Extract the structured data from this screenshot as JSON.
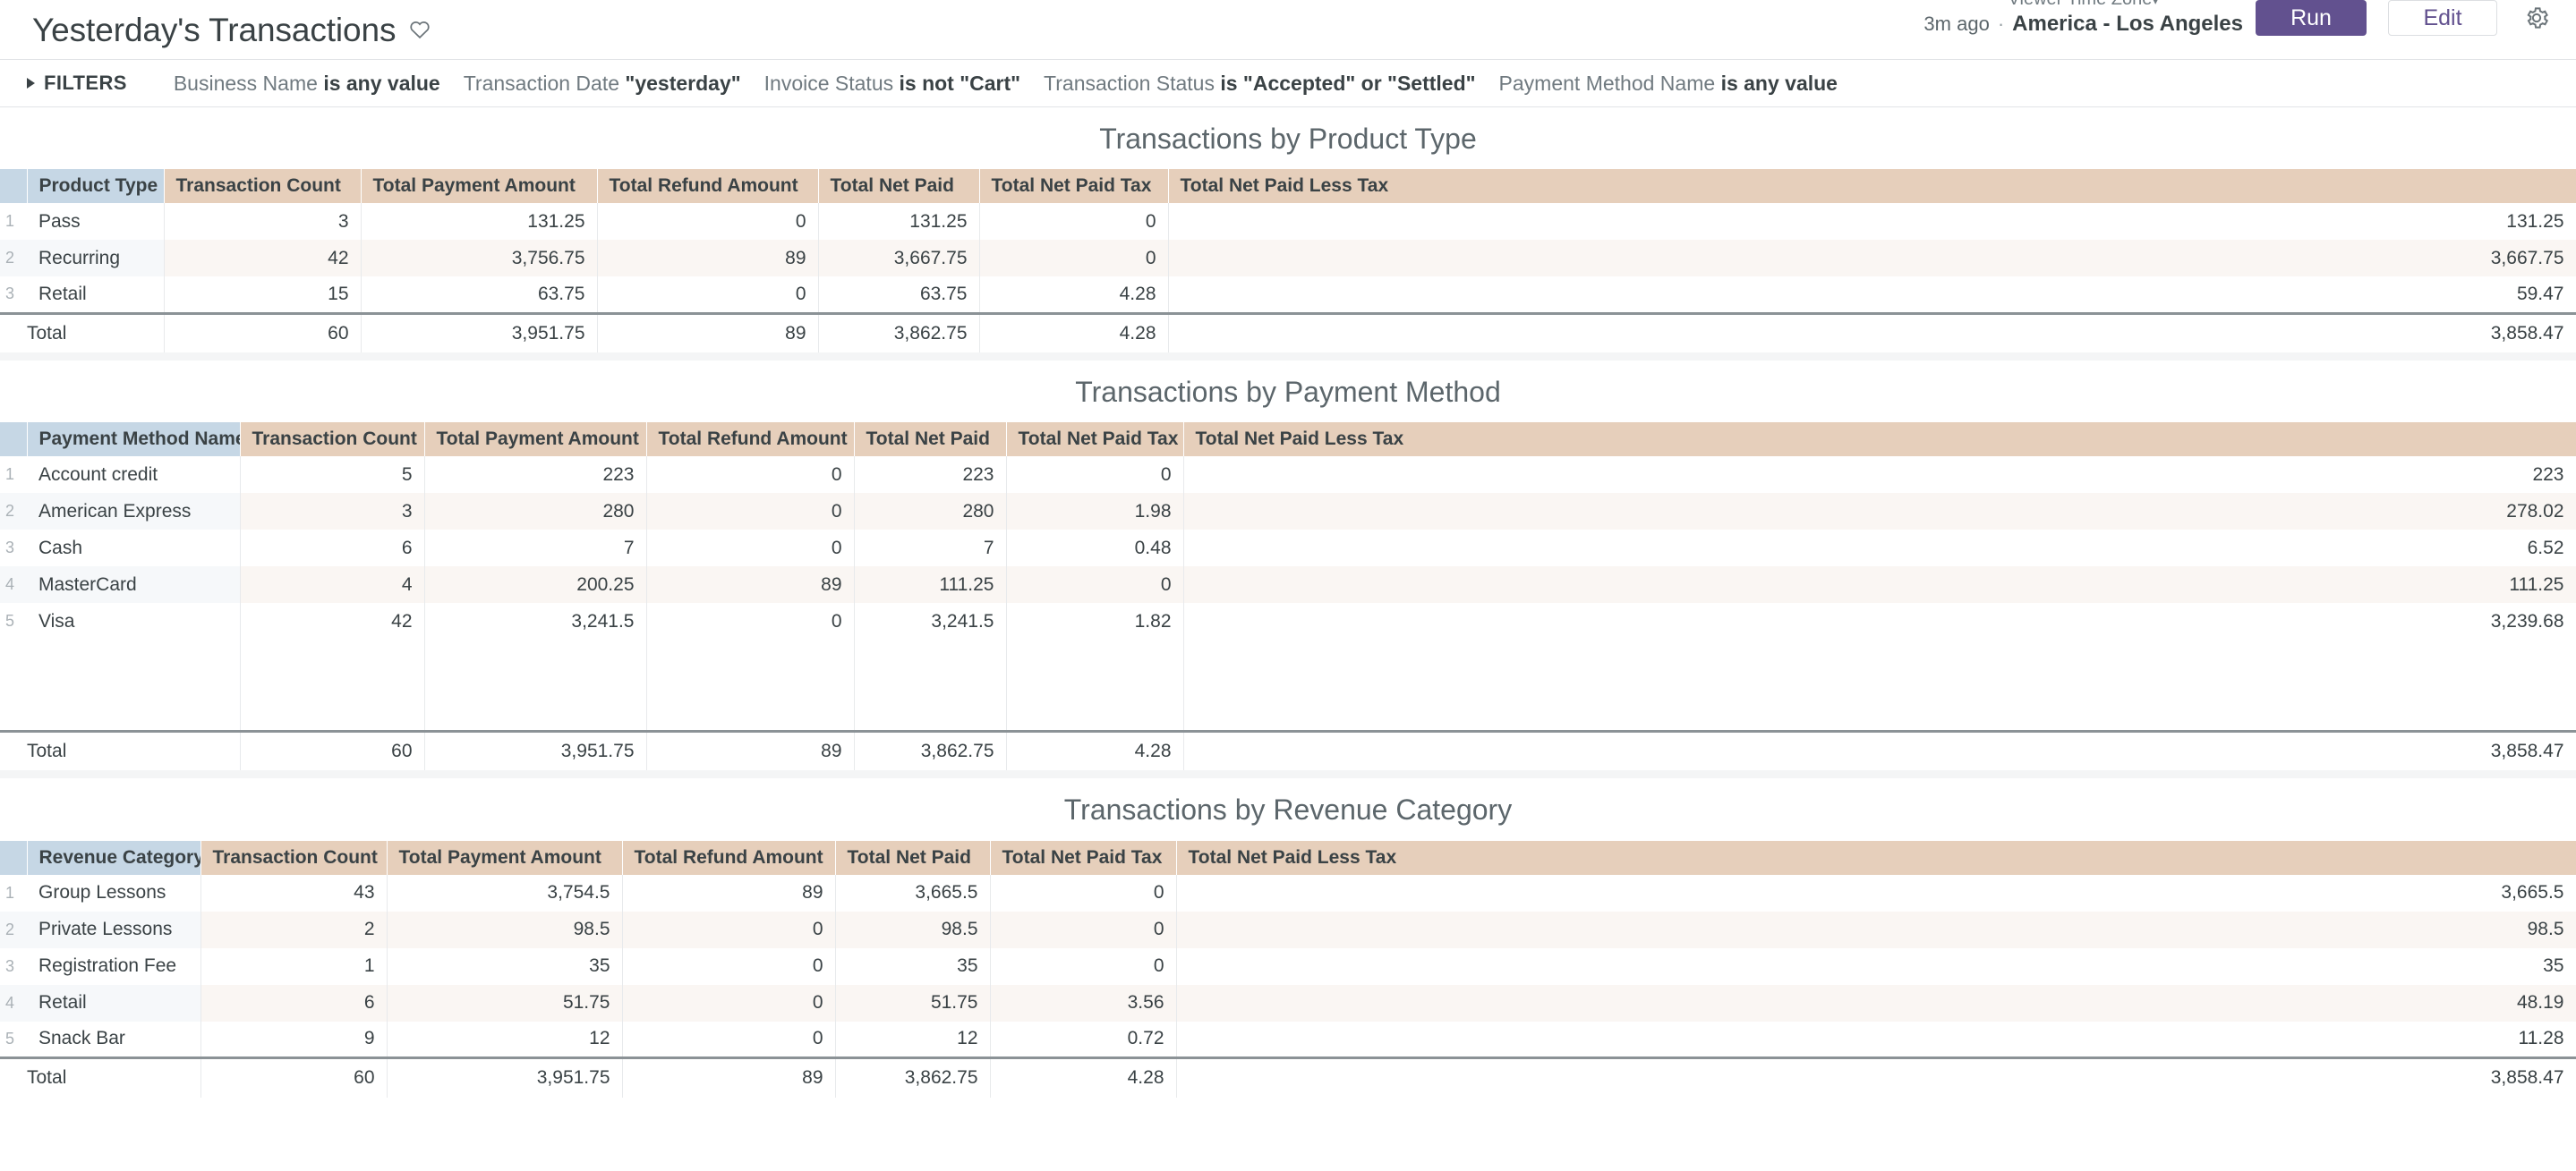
{
  "header": {
    "dashboard_title": "Yesterday's Transactions",
    "favorite_icon": "heart-icon",
    "timezone_label": "Viewer Time Zone",
    "timezone_caret": "▾",
    "last_run": "3m ago",
    "separator_dot": "·",
    "timezone_value": "America - Los Angeles",
    "run_label": "Run",
    "edit_label": "Edit",
    "gear_icon": "gear-icon",
    "accent_purple": "#62518f"
  },
  "filters": {
    "toggle_label": "FILTERS",
    "chips": [
      {
        "field": "Business Name",
        "value": "is any value"
      },
      {
        "field": "Transaction Date",
        "value": "\"yesterday\""
      },
      {
        "field": "Invoice Status",
        "value": "is not \"Cart\""
      },
      {
        "field": "Transaction Status",
        "value": "is \"Accepted\" or \"Settled\""
      },
      {
        "field": "Payment Method Name",
        "value": "is any value"
      }
    ]
  },
  "colors": {
    "dimension_header": "#c6d7e5",
    "measure_header": "#e6cfbb",
    "even_row": "#faf6f3",
    "even_dim_row": "#f6f8fa",
    "total_rule": "#8b9296"
  },
  "tiles": [
    {
      "title": "Transactions by Product Type",
      "sort_caret": "∧",
      "columns": [
        "Product Type",
        "Transaction Count",
        "Total Payment Amount",
        "Total Refund Amount",
        "Total Net Paid",
        "Total Net Paid Tax",
        "Total Net Paid Less Tax"
      ],
      "rows": [
        {
          "n": "1",
          "cells": [
            "Pass",
            "3",
            "131.25",
            "0",
            "131.25",
            "0",
            "131.25"
          ]
        },
        {
          "n": "2",
          "cells": [
            "Recurring",
            "42",
            "3,756.75",
            "89",
            "3,667.75",
            "0",
            "3,667.75"
          ]
        },
        {
          "n": "3",
          "cells": [
            "Retail",
            "15",
            "63.75",
            "0",
            "63.75",
            "4.28",
            "59.47"
          ]
        }
      ],
      "total": {
        "label": "Total",
        "cells": [
          "60",
          "3,951.75",
          "89",
          "3,862.75",
          "4.28",
          "3,858.47"
        ]
      },
      "filler_rows": 0
    },
    {
      "title": "Transactions by Payment Method",
      "sort_caret": "∧",
      "columns": [
        "Payment Method Name",
        "Transaction Count",
        "Total Payment Amount",
        "Total Refund Amount",
        "Total Net Paid",
        "Total Net Paid Tax",
        "Total Net Paid Less Tax"
      ],
      "rows": [
        {
          "n": "1",
          "cells": [
            "Account credit",
            "5",
            "223",
            "0",
            "223",
            "0",
            "223"
          ]
        },
        {
          "n": "2",
          "cells": [
            "American Express",
            "3",
            "280",
            "0",
            "280",
            "1.98",
            "278.02"
          ]
        },
        {
          "n": "3",
          "cells": [
            "Cash",
            "6",
            "7",
            "0",
            "7",
            "0.48",
            "6.52"
          ]
        },
        {
          "n": "4",
          "cells": [
            "MasterCard",
            "4",
            "200.25",
            "89",
            "111.25",
            "0",
            "111.25"
          ]
        },
        {
          "n": "5",
          "cells": [
            "Visa",
            "42",
            "3,241.5",
            "0",
            "3,241.5",
            "1.82",
            "3,239.68"
          ]
        }
      ],
      "total": {
        "label": "Total",
        "cells": [
          "60",
          "3,951.75",
          "89",
          "3,862.75",
          "4.28",
          "3,858.47"
        ]
      },
      "filler_rows": 1
    },
    {
      "title": "Transactions by Revenue Category",
      "sort_caret": "∧",
      "columns": [
        "Revenue Category",
        "Transaction Count",
        "Total Payment Amount",
        "Total Refund Amount",
        "Total Net Paid",
        "Total Net Paid Tax",
        "Total Net Paid Less Tax"
      ],
      "rows": [
        {
          "n": "1",
          "cells": [
            "Group Lessons",
            "43",
            "3,754.5",
            "89",
            "3,665.5",
            "0",
            "3,665.5"
          ]
        },
        {
          "n": "2",
          "cells": [
            "Private Lessons",
            "2",
            "98.5",
            "0",
            "98.5",
            "0",
            "98.5"
          ]
        },
        {
          "n": "3",
          "cells": [
            "Registration Fee",
            "1",
            "35",
            "0",
            "35",
            "0",
            "35"
          ]
        },
        {
          "n": "4",
          "cells": [
            "Retail",
            "6",
            "51.75",
            "0",
            "51.75",
            "3.56",
            "48.19"
          ]
        },
        {
          "n": "5",
          "cells": [
            "Snack Bar",
            "9",
            "12",
            "0",
            "12",
            "0.72",
            "11.28"
          ]
        }
      ],
      "total": {
        "label": "Total",
        "cells": [
          "60",
          "3,951.75",
          "89",
          "3,862.75",
          "4.28",
          "3,858.47"
        ]
      },
      "filler_rows": 0
    }
  ]
}
